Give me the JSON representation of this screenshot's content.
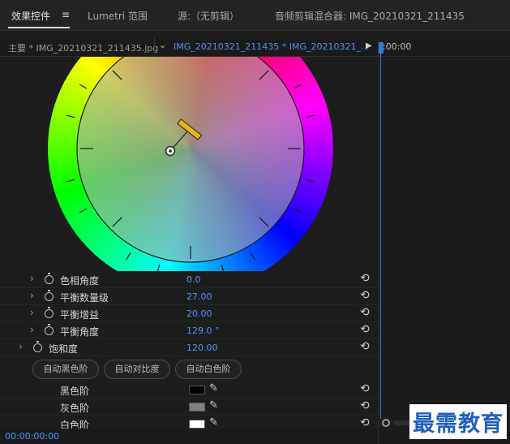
{
  "tabs": [
    {
      "label": "效果控件"
    },
    {
      "label": "Lumetri 范围"
    },
    {
      "label": "源:（无剪辑）"
    },
    {
      "label": "音频剪辑混合器: IMG_20210321_211435"
    }
  ],
  "clip_bar": {
    "master_clip": "主要 * IMG_20210321_211435.jpg",
    "sequence_clip": "IMG_20210321_211435 * IMG_20210321_..."
  },
  "timeline": {
    "ruler_time": ":00:00"
  },
  "properties": [
    {
      "label": "色相角度",
      "value": "0.0"
    },
    {
      "label": "平衡数量级",
      "value": "27.00"
    },
    {
      "label": "平衡增益",
      "value": "20.00"
    },
    {
      "label": "平衡角度",
      "value": "129.0 °"
    },
    {
      "label": "饱和度",
      "value": "120.00"
    }
  ],
  "auto_buttons": [
    "自动黑色阶",
    "自动对比度",
    "自动白色阶"
  ],
  "levels": [
    {
      "label": "黑色阶",
      "color": "#000000"
    },
    {
      "label": "灰色阶",
      "color": "#808080"
    },
    {
      "label": "白色阶",
      "color": "#ffffff"
    }
  ],
  "status": {
    "timecode": "00:00:00:00"
  },
  "watermark": "最需教育",
  "accent_color": "#2e7de0",
  "value_color": "#4f93ff"
}
